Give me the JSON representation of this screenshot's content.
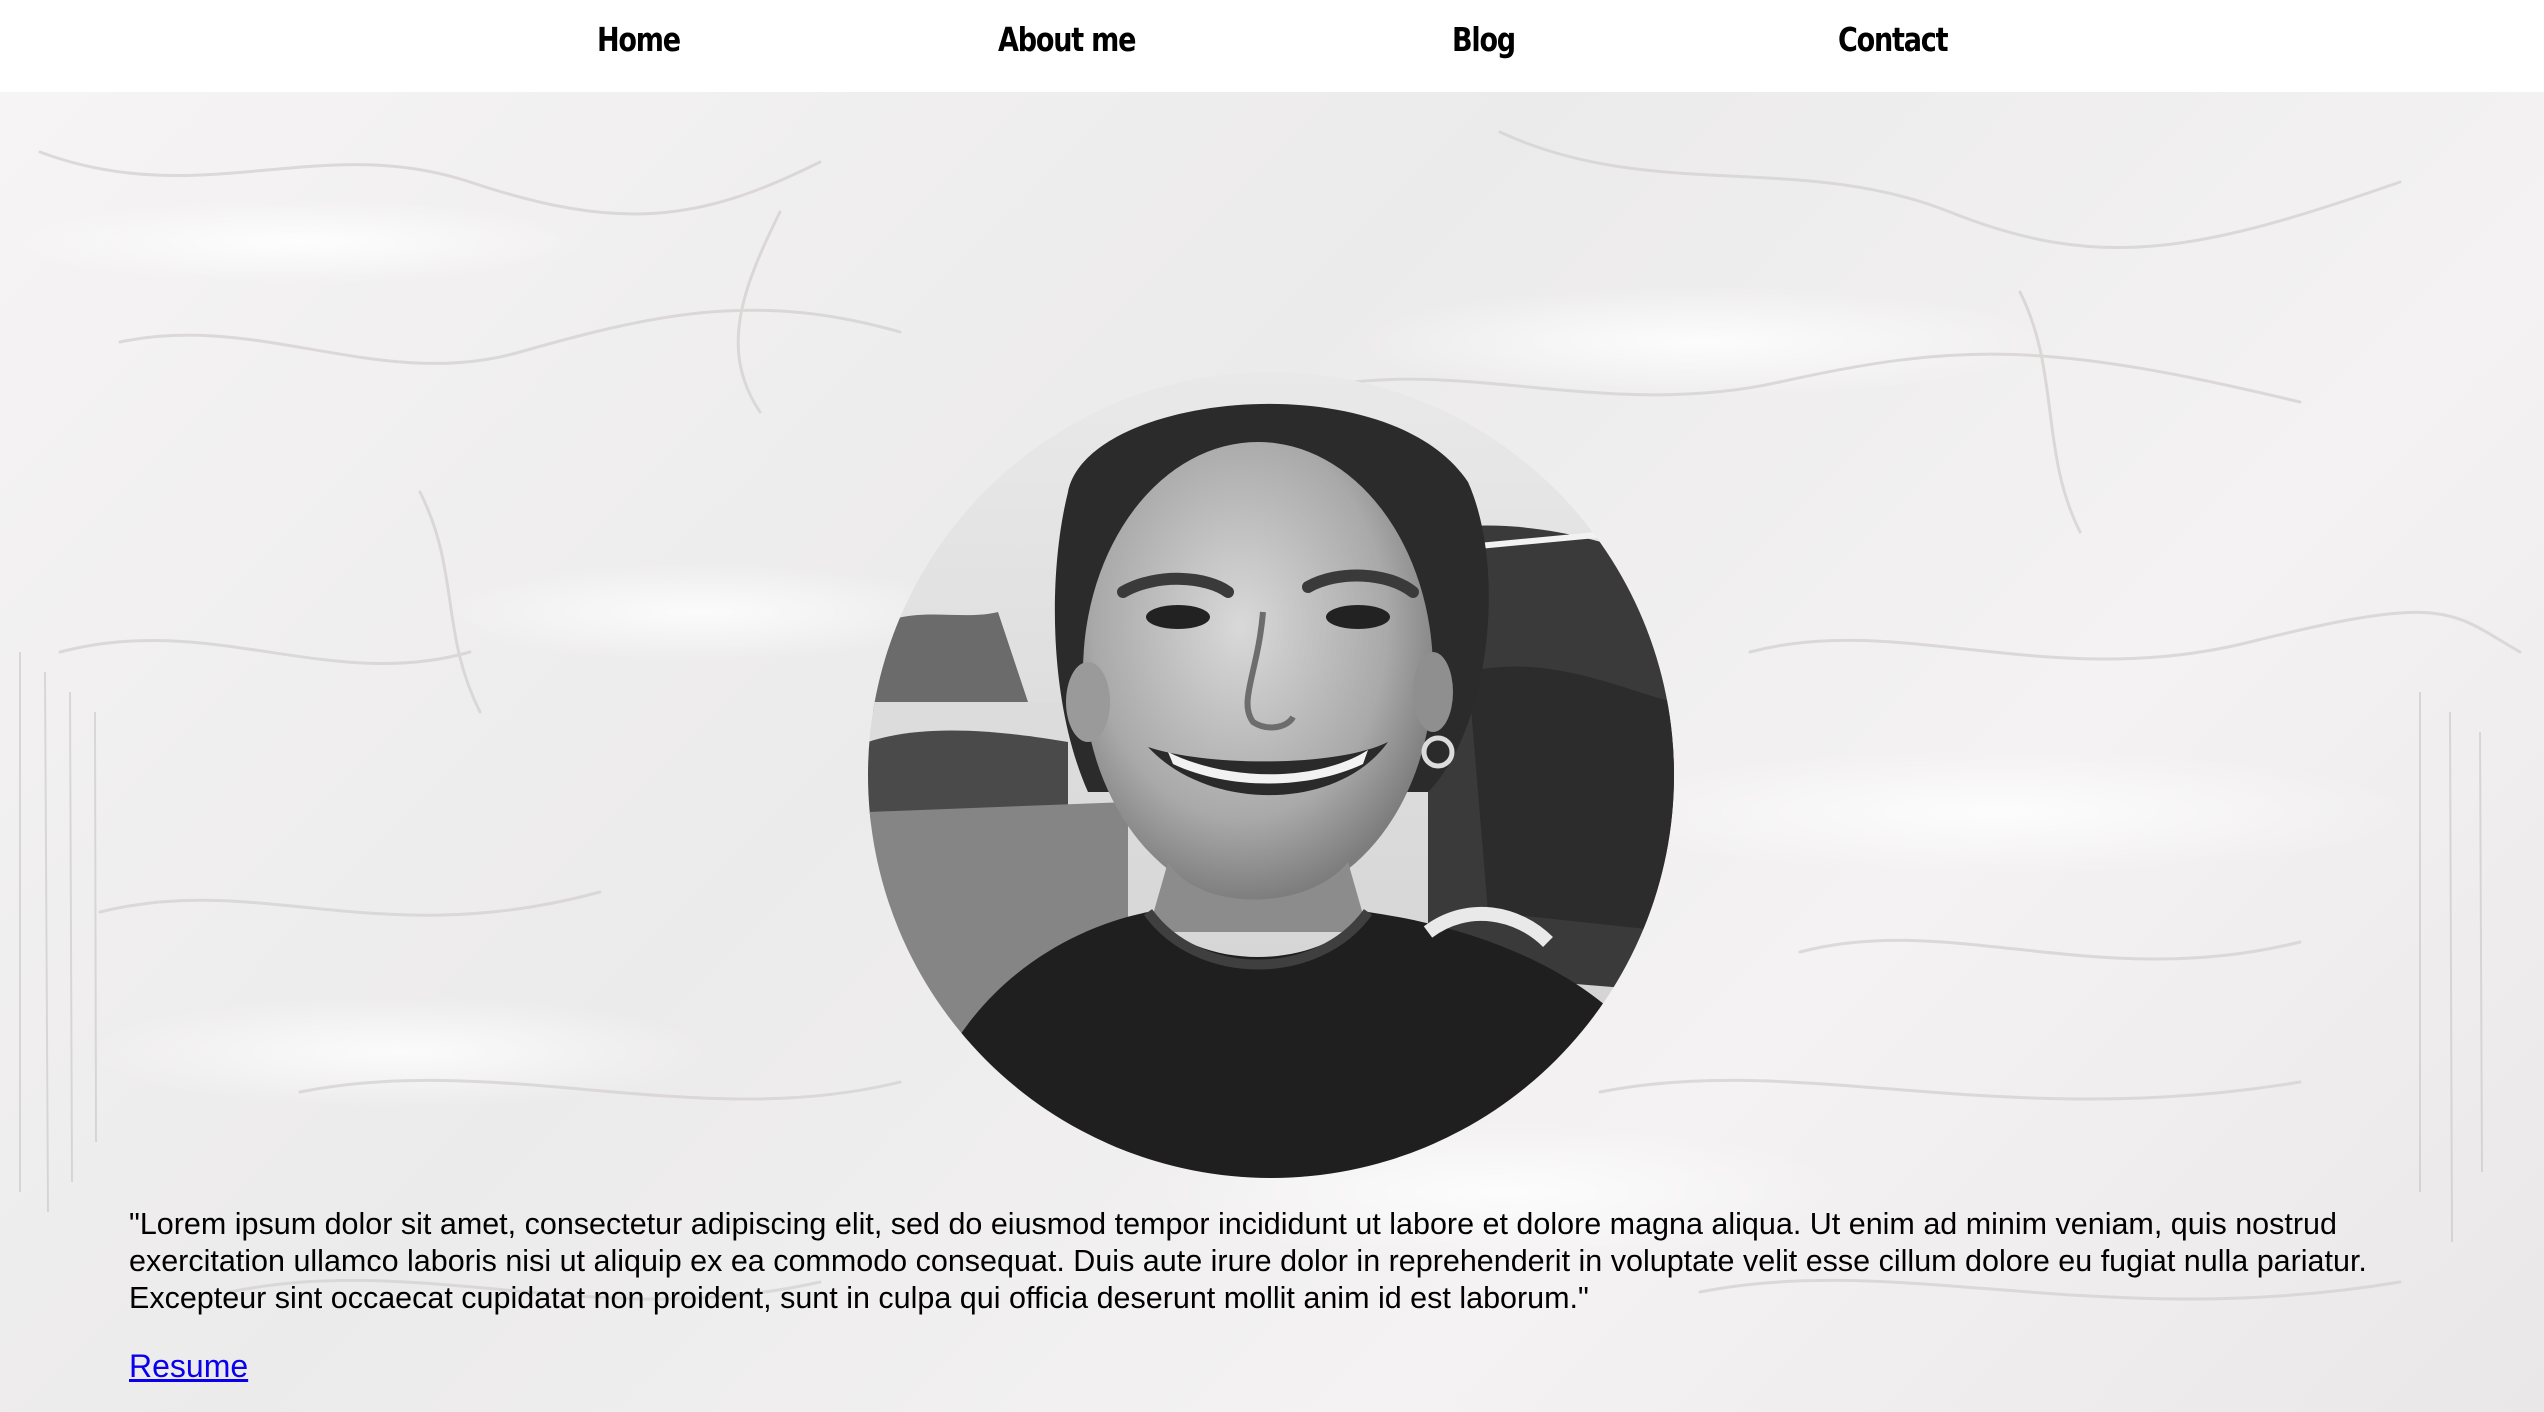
{
  "nav": {
    "items": [
      {
        "label": "Home"
      },
      {
        "label": "About me"
      },
      {
        "label": "Blog"
      },
      {
        "label": "Contact"
      }
    ]
  },
  "profile": {
    "photo_icon": "portrait-photo"
  },
  "about": {
    "quote": "\"Lorem ipsum dolor sit amet, consectetur adipiscing elit, sed do eiusmod tempor incididunt ut labore et dolore magna aliqua. Ut enim ad minim veniam, quis nostrud exercitation ullamco laboris nisi ut aliquip ex ea commodo consequat. Duis aute irure dolor in reprehenderit in voluptate velit esse cillum dolore eu fugiat nulla pariatur. Excepteur sint occaecat cupidatat non proident, sunt in culpa qui officia deserunt mollit anim id est laborum.\"",
    "resume_link": "Resume"
  },
  "colors": {
    "link": "#0b00ee",
    "nav_background": "#ffffff",
    "text": "#000000"
  }
}
